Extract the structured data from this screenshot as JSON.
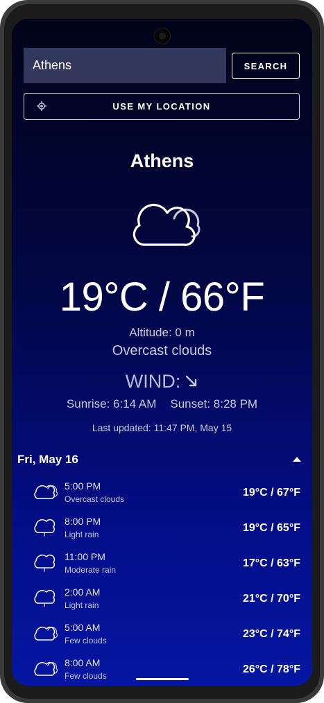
{
  "search": {
    "value": "Athens",
    "button_label": "SEARCH"
  },
  "location_button": {
    "label": "USE MY LOCATION",
    "icon": "crosshair-icon"
  },
  "current": {
    "city": "Athens",
    "icon": "cloud-icon",
    "temperature": "19°C / 66°F",
    "altitude": "Altitude: 0 m",
    "description": "Overcast clouds",
    "wind_label": "WIND:",
    "wind_arrow_icon": "arrow-down-right-icon",
    "sunrise": "Sunrise: 6:14 AM",
    "sunset": "Sunset: 8:28 PM",
    "last_updated": "Last updated: 11:47 PM, May 15"
  },
  "forecast": {
    "day_label": "Fri, May 16",
    "expanded": true,
    "items": [
      {
        "time": "5:00 PM",
        "description": "Overcast clouds",
        "temperature": "19°C / 67°F",
        "icon": "cloud-icon"
      },
      {
        "time": "8:00 PM",
        "description": "Light rain",
        "temperature": "19°C / 65°F",
        "icon": "rain-cloud-icon"
      },
      {
        "time": "11:00 PM",
        "description": "Moderate rain",
        "temperature": "17°C / 63°F",
        "icon": "rain-cloud-icon"
      },
      {
        "time": "2:00 AM",
        "description": "Light rain",
        "temperature": "21°C / 70°F",
        "icon": "rain-cloud-icon"
      },
      {
        "time": "5:00 AM",
        "description": "Few clouds",
        "temperature": "23°C / 74°F",
        "icon": "cloud-icon"
      },
      {
        "time": "8:00 AM",
        "description": "Few clouds",
        "temperature": "26°C / 78°F",
        "icon": "cloud-icon"
      }
    ]
  },
  "colors": {
    "background_top": "#010318",
    "background_bottom": "#0416a2",
    "search_field": "#34375c",
    "text_primary": "#ffffff",
    "text_secondary": "#c9cadc"
  }
}
